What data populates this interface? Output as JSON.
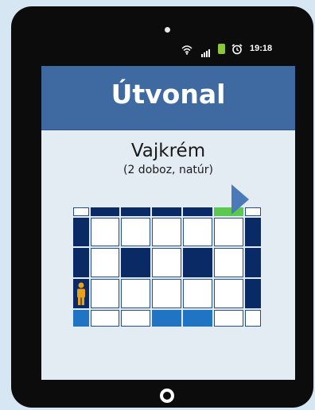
{
  "status_bar": {
    "time": "19:18",
    "icons": [
      "wifi-icon",
      "signal-icon",
      "battery-icon",
      "alarm-icon"
    ],
    "battery_color": "#8cc63e"
  },
  "header": {
    "title": "Útvonal",
    "background": "#3f6aa1"
  },
  "product": {
    "name": "Vajkrém",
    "detail": "(2 doboz, natúr)"
  },
  "store_map": {
    "legend_colors": {
      "empty": "#ffffff",
      "shelf_dark": "#0a2a66",
      "highlight_blue": "#1f74c4",
      "target_green": "#5bc94f",
      "person": "#e7a11c"
    },
    "grid": [
      [
        "empty",
        "shelf_dark",
        "shelf_dark",
        "shelf_dark",
        "shelf_dark",
        "target_green",
        "empty"
      ],
      [
        "shelf_dark",
        "empty",
        "empty",
        "empty",
        "empty",
        "empty",
        "shelf_dark"
      ],
      [
        "shelf_dark",
        "empty",
        "shelf_dark",
        "empty",
        "shelf_dark",
        "empty",
        "shelf_dark"
      ],
      [
        "person",
        "empty",
        "empty",
        "empty",
        "empty",
        "empty",
        "shelf_dark"
      ],
      [
        "highlight_blue",
        "empty",
        "empty",
        "highlight_blue",
        "highlight_blue",
        "empty",
        "empty"
      ]
    ]
  },
  "navigation": {
    "next_icon": "arrow-right-icon",
    "home_icon": "home-button-icon"
  }
}
